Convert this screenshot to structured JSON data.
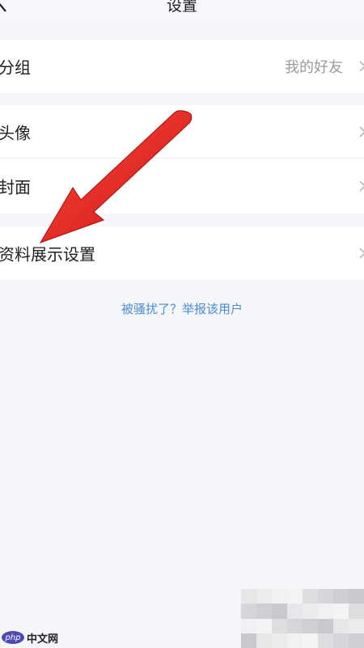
{
  "header": {
    "title": "设置",
    "back_icon": "chevron-left-icon"
  },
  "groups": [
    {
      "rows": [
        {
          "label": "分组",
          "value": "我的好友",
          "chevron_icon": "chevron-right-icon"
        }
      ]
    },
    {
      "rows": [
        {
          "label": "头像",
          "chevron_icon": "chevron-right-icon"
        },
        {
          "label": "封面",
          "chevron_icon": "chevron-right-icon"
        }
      ]
    },
    {
      "rows": [
        {
          "label": "资料展示设置",
          "chevron_icon": "chevron-right-icon"
        }
      ]
    }
  ],
  "report_link": "被骚扰了？举报该用户",
  "watermark": {
    "logo_text": "php",
    "text": "中文网"
  },
  "colors": {
    "background": "#f4f6fa",
    "card": "#ffffff",
    "link": "#4c8cd3",
    "annotation_arrow": "#e0201e",
    "secondary_text": "#9a9a9a"
  }
}
